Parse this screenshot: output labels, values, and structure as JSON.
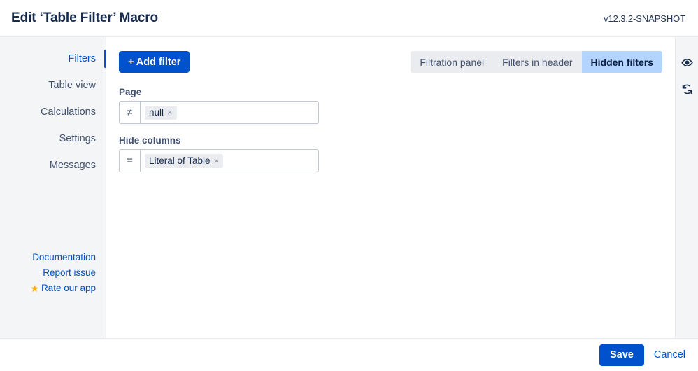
{
  "header": {
    "title": "Edit ‘Table Filter’ Macro",
    "version": "v12.3.2-SNAPSHOT"
  },
  "sidebar": {
    "items": [
      {
        "label": "Filters",
        "active": true
      },
      {
        "label": "Table view",
        "active": false
      },
      {
        "label": "Calculations",
        "active": false
      },
      {
        "label": "Settings",
        "active": false
      },
      {
        "label": "Messages",
        "active": false
      }
    ],
    "footer_links": [
      {
        "label": "Documentation",
        "icon": ""
      },
      {
        "label": "Report issue",
        "icon": ""
      },
      {
        "label": "Rate our app",
        "icon": "star-icon"
      }
    ],
    "star_glyph": "★"
  },
  "toolbar": {
    "add_filter_label": "Add filter",
    "plus_glyph": "+",
    "tabs": [
      {
        "label": "Filtration panel",
        "selected": false
      },
      {
        "label": "Filters in header",
        "selected": false
      },
      {
        "label": "Hidden filters",
        "selected": true
      }
    ]
  },
  "filters": [
    {
      "label": "Page",
      "operator": "≠",
      "operator_name": "not-equals",
      "chips": [
        {
          "text": "null",
          "remove_glyph": "×"
        }
      ]
    },
    {
      "label": "Hide columns",
      "operator": "=",
      "operator_name": "equals",
      "chips": [
        {
          "text": "Literal of Table",
          "remove_glyph": "×"
        }
      ]
    }
  ],
  "rail": {
    "buttons": [
      {
        "icon": "eye-icon",
        "name": "preview-button"
      },
      {
        "icon": "refresh-icon",
        "name": "refresh-button"
      }
    ]
  },
  "footer": {
    "save_label": "Save",
    "cancel_label": "Cancel"
  },
  "colors": {
    "accent": "#0052cc",
    "tab_selected_bg": "#b3d4ff",
    "tab_bg": "#ebecf0",
    "sidebar_bg": "#f4f5f7",
    "star": "#ffab00",
    "text": "#172b4d"
  }
}
